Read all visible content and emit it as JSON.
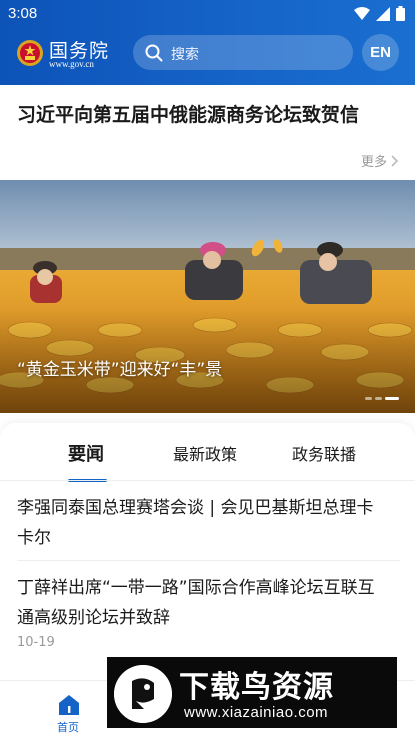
{
  "status_bar": {
    "time": "3:08"
  },
  "header": {
    "brand_name": "国务院",
    "brand_url": "www.gov.cn",
    "search_placeholder": "搜索",
    "en_button": "EN"
  },
  "headline": {
    "title": "习近平向第五届中俄能源商务论坛致贺信",
    "more_label": "更多"
  },
  "banner": {
    "caption": "“黄金玉米带”迎来好“丰”景",
    "slide_count": 3,
    "active_slide": 3
  },
  "tabs": [
    {
      "label": "要闻",
      "active": true
    },
    {
      "label": "最新政策",
      "active": false
    },
    {
      "label": "政务联播",
      "active": false
    }
  ],
  "news": [
    {
      "title_line1": "李强同泰国总理赛塔会谈 | 会见巴基斯坦总理卡",
      "title_line2": "卡尔",
      "date": ""
    },
    {
      "title_line1": "丁薛祥出席“一带一路”国际合作高峰论坛互联互",
      "title_line2": "通高级别论坛并致辞",
      "date": "10-19"
    }
  ],
  "bottom_nav": {
    "home_label": "首页"
  },
  "watermark": {
    "title": "下载鸟资源",
    "url": "www.xiazainiao.com"
  },
  "colors": {
    "primary": "#1563c7",
    "header_start": "#0d53b8",
    "text": "#1a1a1a",
    "muted": "#999999"
  }
}
